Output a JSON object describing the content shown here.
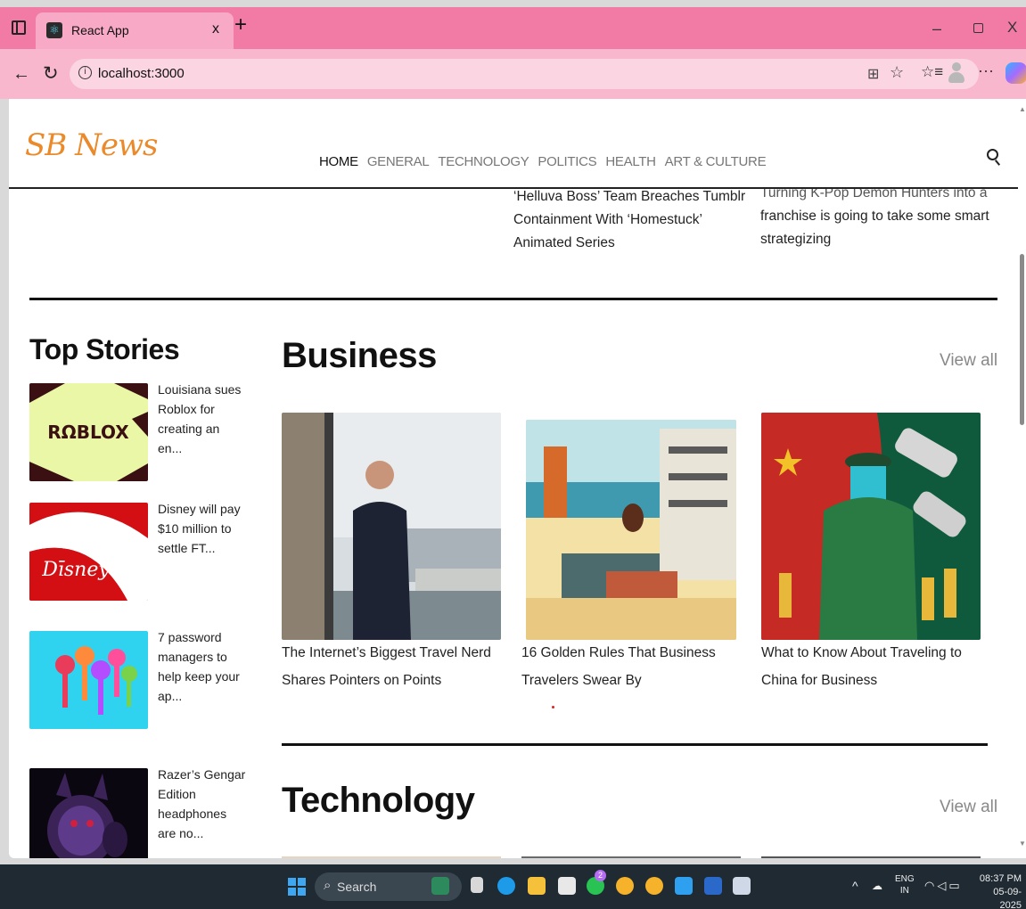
{
  "browser": {
    "tab_title": "React App",
    "tab_close": "x",
    "new_tab": "+",
    "url": "localhost:3000",
    "window_min": "–",
    "window_close": "X"
  },
  "site": {
    "logo": "SB News",
    "nav": [
      "HOME",
      "GENERAL",
      "TECHNOLOGY",
      "POLITICS",
      "HEALTH",
      "ART & CULTURE"
    ],
    "active_nav": "HOME"
  },
  "snippets": {
    "a": "‘Helluva Boss’ Team Breaches Tumblr Containment With ‘Homestuck’ Animated Series",
    "b_cut": "Turning K-Pop Demon Hunters into a",
    "b": "franchise is going to take some smart strategizing"
  },
  "top_stories": {
    "title": "Top Stories",
    "items": [
      {
        "text": "Louisiana sues Roblox for creating an en...",
        "image": "roblox-logo"
      },
      {
        "text": "Disney will pay $10 million to settle FT...",
        "image": "disney-logo"
      },
      {
        "text": "7 password managers to help keep your ap...",
        "image": "colorful-keys"
      },
      {
        "text": "Razer’s Gengar Edition headphones are no...",
        "image": "gengar-headphones"
      }
    ]
  },
  "business": {
    "title": "Business",
    "view_all": "View all",
    "cards": [
      {
        "title": "The Internet’s Biggest Travel Nerd Shares Pointers on Points"
      },
      {
        "title": "16 Golden Rules That Business Travelers Swear By"
      },
      {
        "title": "What to Know About Traveling to China for Business"
      }
    ]
  },
  "technology": {
    "title": "Technology",
    "view_all": "View all"
  },
  "taskbar": {
    "search_label": "Search",
    "lang_top": "ENG",
    "lang_bottom": "IN",
    "time": "08:37 PM",
    "date": "05-09-2025",
    "badge": "2"
  },
  "colors": {
    "tabbar": "#f27ba6",
    "addressbar": "#f8b7cd",
    "logo": "#ea8a2a",
    "taskbar": "#1f2a33"
  }
}
